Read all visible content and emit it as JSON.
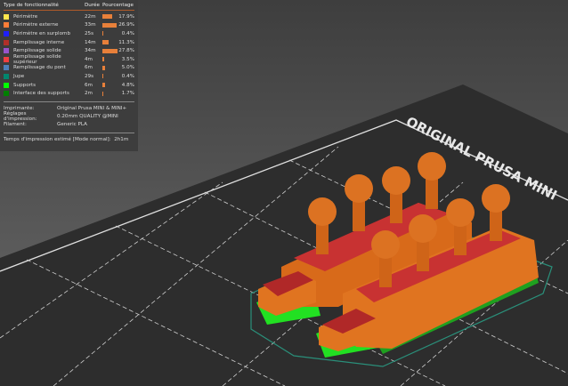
{
  "legend": {
    "headers": {
      "type": "Type de fonctionnalité",
      "duration": "Durée",
      "percent": "Pourcentage"
    },
    "items": [
      {
        "label": "Périmètre",
        "duration": "22m",
        "percent": "17.9%",
        "value": 17.9,
        "color": "#ffe64d"
      },
      {
        "label": "Périmètre externe",
        "duration": "33m",
        "percent": "26.9%",
        "value": 26.9,
        "color": "#ff7d38"
      },
      {
        "label": "Périmètre en surplomb",
        "duration": "25s",
        "percent": "0.4%",
        "value": 0.4,
        "color": "#1f1fff"
      },
      {
        "label": "Remplissage interne",
        "duration": "14m",
        "percent": "11.3%",
        "value": 11.3,
        "color": "#b03029"
      },
      {
        "label": "Remplissage solide",
        "duration": "34m",
        "percent": "27.8%",
        "value": 27.8,
        "color": "#9654cc"
      },
      {
        "label": "Remplissage solide supérieur",
        "duration": "4m",
        "percent": "3.5%",
        "value": 3.5,
        "color": "#f04040"
      },
      {
        "label": "Remplissage du pont",
        "duration": "6m",
        "percent": "5.0%",
        "value": 5.0,
        "color": "#4d80ba"
      },
      {
        "label": "Jupe",
        "duration": "29s",
        "percent": "0.4%",
        "value": 0.4,
        "color": "#00876e"
      },
      {
        "label": "Supports",
        "duration": "6m",
        "percent": "4.8%",
        "value": 4.8,
        "color": "#00ff00"
      },
      {
        "label": "Interface des supports",
        "duration": "2m",
        "percent": "1.7%",
        "value": 1.7,
        "color": "#008000"
      }
    ]
  },
  "info": [
    {
      "key": "Imprimante:",
      "value": "Original Prusa MINI & MINI+"
    },
    {
      "key": "Réglages d'impression:",
      "value": "0.20mm QUALITY @MINI"
    },
    {
      "key": "Filament:",
      "value": "Generic PLA"
    }
  ],
  "estimate": {
    "label": "Temps d'impression estimé [Mode normal]:",
    "value": "2h1m"
  },
  "bed_label": "ORIGINAL PRUSA MINI"
}
